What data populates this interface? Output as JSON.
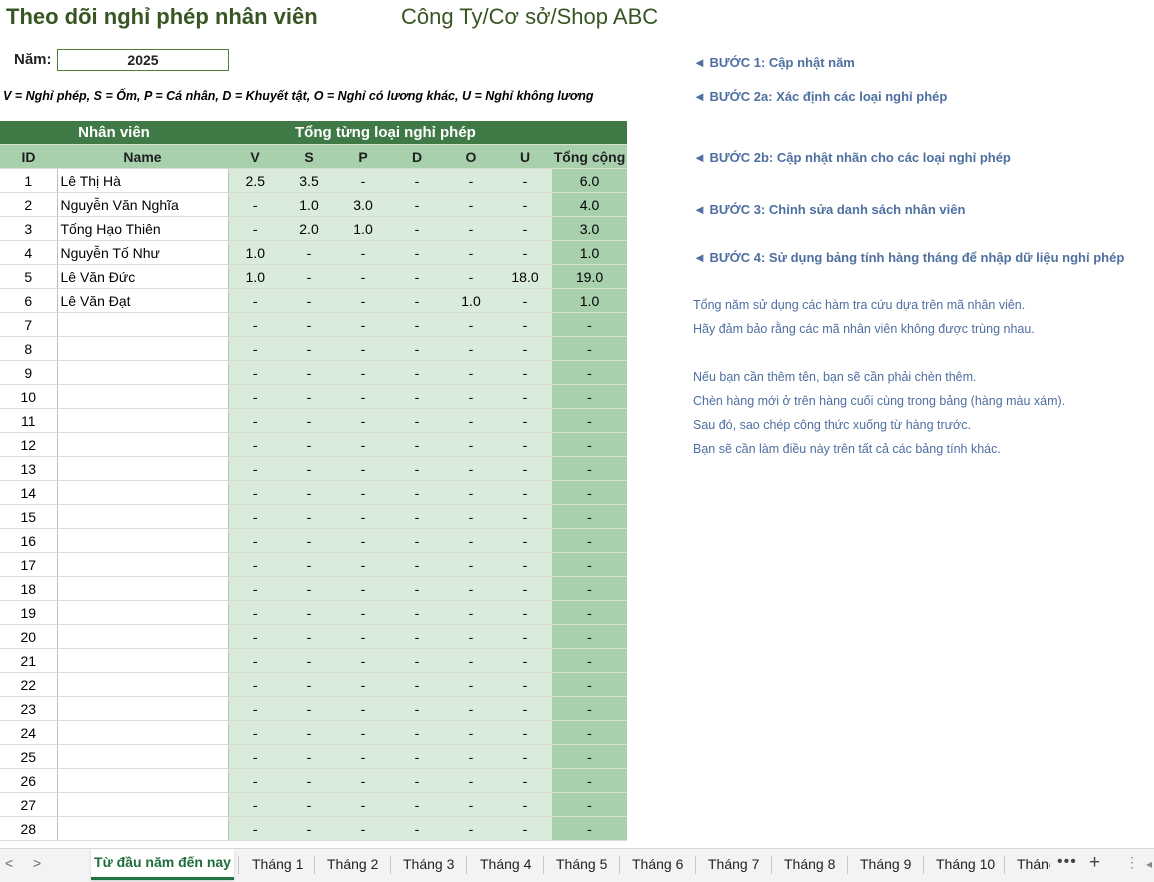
{
  "header": {
    "title": "Theo dõi nghỉ phép nhân viên",
    "company": "Công Ty/Cơ sở/Shop ABC",
    "year_label": "Năm:",
    "year_value": "2025",
    "legend": "V = Nghỉ phép, S = Ốm, P = Cá nhân, D = Khuyết tật, O = Nghỉ có lương khác, U = Nghỉ không lương"
  },
  "table": {
    "group_employee": "Nhân viên",
    "group_totals": "Tổng từng loại nghỉ phép",
    "columns": [
      "ID",
      "Name",
      "V",
      "S",
      "P",
      "D",
      "O",
      "U",
      "Tổng cộng"
    ],
    "rows": [
      {
        "id": "1",
        "name": "Lê Thị Hà",
        "v": "2.5",
        "s": "3.5",
        "p": "-",
        "d": "-",
        "o": "-",
        "u": "-",
        "total": "6.0"
      },
      {
        "id": "2",
        "name": "Nguyễn Văn Nghĩa",
        "v": "-",
        "s": "1.0",
        "p": "3.0",
        "d": "-",
        "o": "-",
        "u": "-",
        "total": "4.0"
      },
      {
        "id": "3",
        "name": "Tống Hạo Thiên",
        "v": "-",
        "s": "2.0",
        "p": "1.0",
        "d": "-",
        "o": "-",
        "u": "-",
        "total": "3.0"
      },
      {
        "id": "4",
        "name": "Nguyễn Tố Như",
        "v": "1.0",
        "s": "-",
        "p": "-",
        "d": "-",
        "o": "-",
        "u": "-",
        "total": "1.0"
      },
      {
        "id": "5",
        "name": "Lê Văn Đức",
        "v": "1.0",
        "s": "-",
        "p": "-",
        "d": "-",
        "o": "-",
        "u": "18.0",
        "total": "19.0"
      },
      {
        "id": "6",
        "name": "Lê Văn Đạt",
        "v": "-",
        "s": "-",
        "p": "-",
        "d": "-",
        "o": "1.0",
        "u": "-",
        "total": "1.0"
      },
      {
        "id": "7",
        "name": "",
        "v": "-",
        "s": "-",
        "p": "-",
        "d": "-",
        "o": "-",
        "u": "-",
        "total": "-"
      },
      {
        "id": "8",
        "name": "",
        "v": "-",
        "s": "-",
        "p": "-",
        "d": "-",
        "o": "-",
        "u": "-",
        "total": "-"
      },
      {
        "id": "9",
        "name": "",
        "v": "-",
        "s": "-",
        "p": "-",
        "d": "-",
        "o": "-",
        "u": "-",
        "total": "-"
      },
      {
        "id": "10",
        "name": "",
        "v": "-",
        "s": "-",
        "p": "-",
        "d": "-",
        "o": "-",
        "u": "-",
        "total": "-"
      },
      {
        "id": "11",
        "name": "",
        "v": "-",
        "s": "-",
        "p": "-",
        "d": "-",
        "o": "-",
        "u": "-",
        "total": "-"
      },
      {
        "id": "12",
        "name": "",
        "v": "-",
        "s": "-",
        "p": "-",
        "d": "-",
        "o": "-",
        "u": "-",
        "total": "-"
      },
      {
        "id": "13",
        "name": "",
        "v": "-",
        "s": "-",
        "p": "-",
        "d": "-",
        "o": "-",
        "u": "-",
        "total": "-"
      },
      {
        "id": "14",
        "name": "",
        "v": "-",
        "s": "-",
        "p": "-",
        "d": "-",
        "o": "-",
        "u": "-",
        "total": "-"
      },
      {
        "id": "15",
        "name": "",
        "v": "-",
        "s": "-",
        "p": "-",
        "d": "-",
        "o": "-",
        "u": "-",
        "total": "-"
      },
      {
        "id": "16",
        "name": "",
        "v": "-",
        "s": "-",
        "p": "-",
        "d": "-",
        "o": "-",
        "u": "-",
        "total": "-"
      },
      {
        "id": "17",
        "name": "",
        "v": "-",
        "s": "-",
        "p": "-",
        "d": "-",
        "o": "-",
        "u": "-",
        "total": "-"
      },
      {
        "id": "18",
        "name": "",
        "v": "-",
        "s": "-",
        "p": "-",
        "d": "-",
        "o": "-",
        "u": "-",
        "total": "-"
      },
      {
        "id": "19",
        "name": "",
        "v": "-",
        "s": "-",
        "p": "-",
        "d": "-",
        "o": "-",
        "u": "-",
        "total": "-"
      },
      {
        "id": "20",
        "name": "",
        "v": "-",
        "s": "-",
        "p": "-",
        "d": "-",
        "o": "-",
        "u": "-",
        "total": "-"
      },
      {
        "id": "21",
        "name": "",
        "v": "-",
        "s": "-",
        "p": "-",
        "d": "-",
        "o": "-",
        "u": "-",
        "total": "-"
      },
      {
        "id": "22",
        "name": "",
        "v": "-",
        "s": "-",
        "p": "-",
        "d": "-",
        "o": "-",
        "u": "-",
        "total": "-"
      },
      {
        "id": "23",
        "name": "",
        "v": "-",
        "s": "-",
        "p": "-",
        "d": "-",
        "o": "-",
        "u": "-",
        "total": "-"
      },
      {
        "id": "24",
        "name": "",
        "v": "-",
        "s": "-",
        "p": "-",
        "d": "-",
        "o": "-",
        "u": "-",
        "total": "-"
      },
      {
        "id": "25",
        "name": "",
        "v": "-",
        "s": "-",
        "p": "-",
        "d": "-",
        "o": "-",
        "u": "-",
        "total": "-"
      },
      {
        "id": "26",
        "name": "",
        "v": "-",
        "s": "-",
        "p": "-",
        "d": "-",
        "o": "-",
        "u": "-",
        "total": "-"
      },
      {
        "id": "27",
        "name": "",
        "v": "-",
        "s": "-",
        "p": "-",
        "d": "-",
        "o": "-",
        "u": "-",
        "total": "-"
      },
      {
        "id": "28",
        "name": "",
        "v": "-",
        "s": "-",
        "p": "-",
        "d": "-",
        "o": "-",
        "u": "-",
        "total": "-"
      }
    ]
  },
  "steps": [
    "◄ BƯỚC 1: Cập nhật năm",
    "◄ BƯỚC 2a: Xác định các loại nghỉ phép",
    "◄ BƯỚC 2b: Cập nhật nhãn cho các loại nghỉ phép",
    "◄ BƯỚC 3: Chỉnh sửa danh sách nhân viên",
    "◄ BƯỚC 4: Sử dụng bảng tính hàng tháng để nhập dữ liệu nghỉ phép"
  ],
  "notes": [
    "Tổng năm sử dụng các hàm tra cứu dựa trên mã nhân viên.",
    "Hãy đảm bảo rằng các mã nhân viên không được trùng nhau.",
    "Nếu bạn cần thêm tên, bạn sẽ cần phải chèn thêm.",
    "Chèn hàng mới ở trên hàng cuối cùng trong bảng (hàng màu xám).",
    "Sau đó, sao chép công thức xuống từ hàng trước.",
    "Bạn sẽ cần làm điều này trên tất cả các bảng tính khác."
  ],
  "sheet_tabs": {
    "nav_prev": "<",
    "nav_next": ">",
    "active": "Từ đầu năm đến nay",
    "tabs": [
      "Tháng 1",
      "Tháng 2",
      "Tháng 3",
      "Tháng 4",
      "Tháng 5",
      "Tháng 6",
      "Tháng 7",
      "Tháng 8",
      "Tháng 9",
      "Tháng 10",
      "Tháng"
    ],
    "more": "•••",
    "add": "+",
    "options": "⋮",
    "scroll": "◂"
  }
}
